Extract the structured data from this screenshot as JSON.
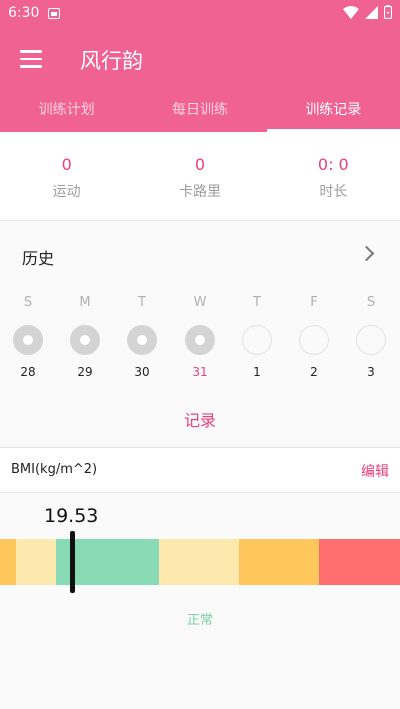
{
  "statusbar": {
    "time": "6:30"
  },
  "app": {
    "title": "风行韵"
  },
  "tabs": [
    {
      "label": "训练计划",
      "active": false
    },
    {
      "label": "每日训练",
      "active": false
    },
    {
      "label": "训练记录",
      "active": true
    }
  ],
  "stats": [
    {
      "value": "0",
      "label": "运动"
    },
    {
      "value": "0",
      "label": "卡路里"
    },
    {
      "value": "0: 0",
      "label": "时长"
    }
  ],
  "history": {
    "title": "历史",
    "days": [
      {
        "dow": "S",
        "date": "28",
        "done": true,
        "today": false
      },
      {
        "dow": "M",
        "date": "29",
        "done": true,
        "today": false
      },
      {
        "dow": "T",
        "date": "30",
        "done": true,
        "today": false
      },
      {
        "dow": "W",
        "date": "31",
        "done": true,
        "today": true
      },
      {
        "dow": "T",
        "date": "1",
        "done": false,
        "today": false
      },
      {
        "dow": "F",
        "date": "2",
        "done": false,
        "today": false
      },
      {
        "dow": "S",
        "date": "3",
        "done": false,
        "today": false
      }
    ],
    "record_label": "记录"
  },
  "bmi": {
    "label": "BMI(kg/m^2)",
    "edit_label": "编辑",
    "value": "19.53",
    "status": "正常",
    "scale_colors": [
      "#FFC65C",
      "#FDE9AE",
      "#88DAB5",
      "#FDE9AE",
      "#FFC65C",
      "#FF6E6E"
    ]
  },
  "colors": {
    "accent": "#F06292",
    "accent_text": "#EC407A"
  }
}
